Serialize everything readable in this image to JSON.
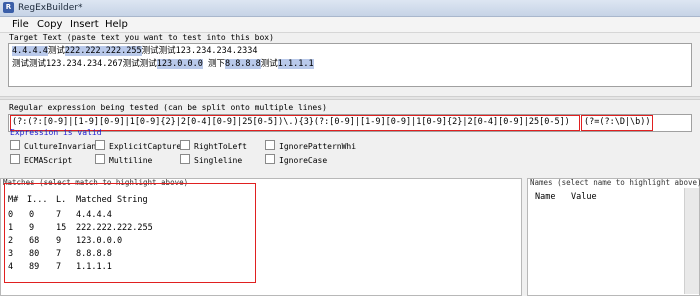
{
  "window": {
    "title": "RegExBuilder*",
    "icon_text": "R"
  },
  "menu": [
    {
      "label": "File"
    },
    {
      "label": "Copy"
    },
    {
      "label": "Insert"
    },
    {
      "label": "Help"
    }
  ],
  "target": {
    "label": "Target Text (paste text you want to test into this box)",
    "line1": [
      {
        "text": "4.4.4.4",
        "hl": true
      },
      {
        "text": "测试",
        "hl": false
      },
      {
        "text": "222.222.222.255",
        "hl": true
      },
      {
        "text": "测试测试123.234.234.2334",
        "hl": false
      }
    ],
    "line2": [
      {
        "text": "测试测试123.234.234.267测试测试",
        "hl": false
      },
      {
        "text": "123.0.0.0",
        "hl": true
      },
      {
        "text": " 测下",
        "hl": false
      },
      {
        "text": "8.8.8.8",
        "hl": true
      },
      {
        "text": "测试",
        "hl": false
      },
      {
        "text": "1.1.1.1",
        "hl": true
      }
    ]
  },
  "regex": {
    "label": "Regular expression being tested (can be split onto multiple lines)",
    "main": "(?:(?:[0-9]|[1-9][0-9]|1[0-9]{2}|2[0-4][0-9]|25[0-5])\\.){3}(?:[0-9]|[1-9][0-9]|1[0-9]{2}|2[0-4][0-9]|25[0-5])",
    "tail": "(?=(?:\\D|\\b))",
    "status": "Expression is valid"
  },
  "options": [
    {
      "label": "CultureInvariant"
    },
    {
      "label": "ExplicitCapture"
    },
    {
      "label": "RightToLeft"
    },
    {
      "label": "IgnorePatternWhi"
    },
    {
      "label": "ECMAScript"
    },
    {
      "label": "Multiline"
    },
    {
      "label": "Singleline"
    },
    {
      "label": "IgnoreCase"
    }
  ],
  "matches": {
    "label": "Matches (select match to highlight above)",
    "headers": {
      "num": "M#",
      "index": "I...",
      "length": "L.",
      "string": "Matched String"
    },
    "rows": [
      {
        "num": "0",
        "index": "0",
        "length": "7",
        "string": "4.4.4.4"
      },
      {
        "num": "1",
        "index": "9",
        "length": "15",
        "string": "222.222.222.255"
      },
      {
        "num": "2",
        "index": "68",
        "length": "9",
        "string": "123.0.0.0"
      },
      {
        "num": "3",
        "index": "80",
        "length": "7",
        "string": "8.8.8.8"
      },
      {
        "num": "4",
        "index": "89",
        "length": "7",
        "string": "1.1.1.1"
      }
    ]
  },
  "names": {
    "label": "Names (select name to highlight above)",
    "headers": {
      "name": "Name",
      "value": "Value"
    }
  },
  "colors": {
    "highlight": "#b9c9ea",
    "annotation": "#e02020",
    "status": "#1a1ad0"
  }
}
